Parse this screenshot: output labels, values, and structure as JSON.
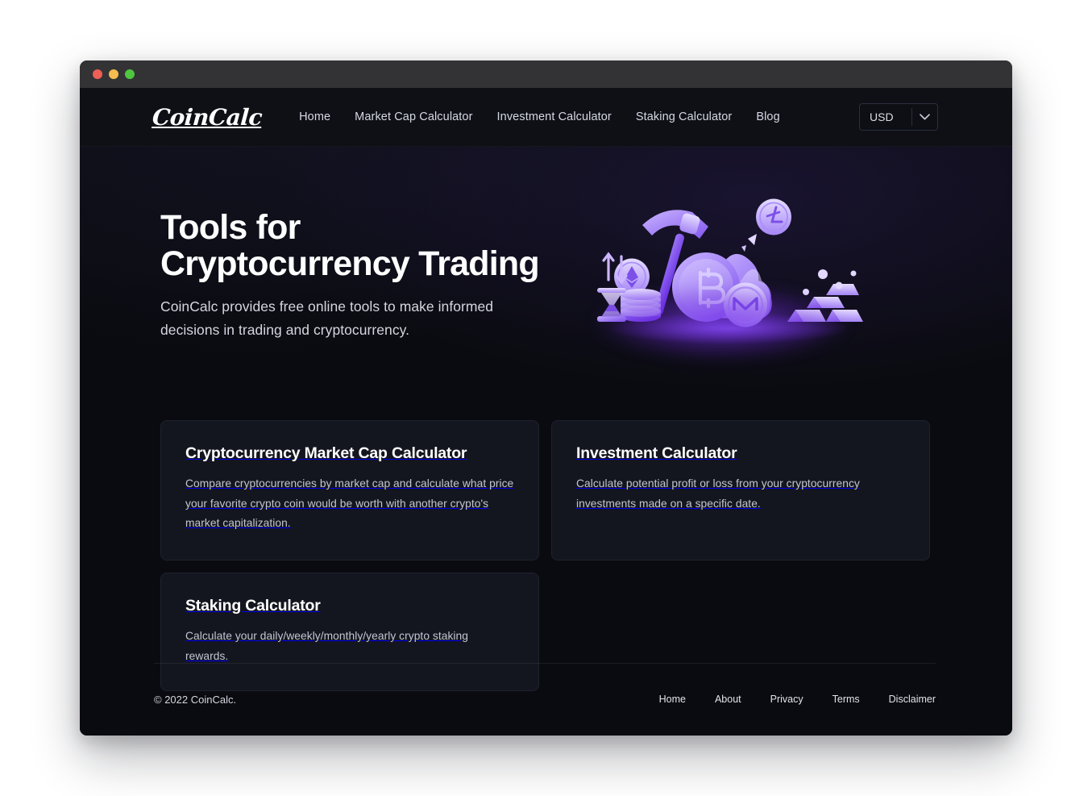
{
  "window": {
    "traffic_lights": [
      {
        "name": "close",
        "color": "#ef5f56"
      },
      {
        "name": "minimize",
        "color": "#f5bd4f"
      },
      {
        "name": "maximize",
        "color": "#4fc540"
      }
    ]
  },
  "brand": {
    "logo_text": "CoinCalc"
  },
  "nav": {
    "links": [
      {
        "label": "Home"
      },
      {
        "label": "Market Cap Calculator"
      },
      {
        "label": "Investment Calculator"
      },
      {
        "label": "Staking Calculator"
      },
      {
        "label": "Blog"
      }
    ],
    "currency": {
      "selected": "USD",
      "icon": "chevron-down-icon"
    }
  },
  "hero": {
    "title": "Tools for Cryptocurrency Trading",
    "subtitle": "CoinCalc provides free online tools to make informed decisions in trading and cryptocurrency.",
    "illustration": {
      "name": "crypto-mining-illustration",
      "elements": [
        "pickaxe",
        "bitcoin-coin",
        "ethereum-coin",
        "litecoin-coin",
        "monero-coin",
        "rock",
        "gold-bars",
        "hourglass",
        "coin-stack",
        "up-down-arrows"
      ],
      "accent": "#8b5cf6",
      "glow": "#7c3aed"
    }
  },
  "cards": [
    {
      "title": "Cryptocurrency Market Cap Calculator",
      "description": "Compare cryptocurrencies by market cap and calculate what price your favorite crypto coin would be worth with another crypto's market capitalization.",
      "size": "large"
    },
    {
      "title": "Investment Calculator",
      "description": "Calculate potential profit or loss from your cryptocurrency investments made on a specific date.",
      "size": "large"
    },
    {
      "title": "Staking Calculator",
      "description": "Calculate your daily/weekly/monthly/yearly crypto staking rewards.",
      "size": "small"
    }
  ],
  "footer": {
    "copyright": "© 2022 CoinCalc.",
    "links": [
      {
        "label": "Home"
      },
      {
        "label": "About"
      },
      {
        "label": "Privacy"
      },
      {
        "label": "Terms"
      },
      {
        "label": "Disclaimer"
      }
    ]
  },
  "theme": {
    "page_bg": "#0a0b10",
    "nav_bg": "#0e1016",
    "card_bg": "#14161f",
    "card_border": "#1e2230",
    "titlebar_bg": "#333335",
    "accent_purple": "#8b5cf6",
    "text_primary": "#ffffff",
    "text_secondary": "#d4d6df"
  }
}
